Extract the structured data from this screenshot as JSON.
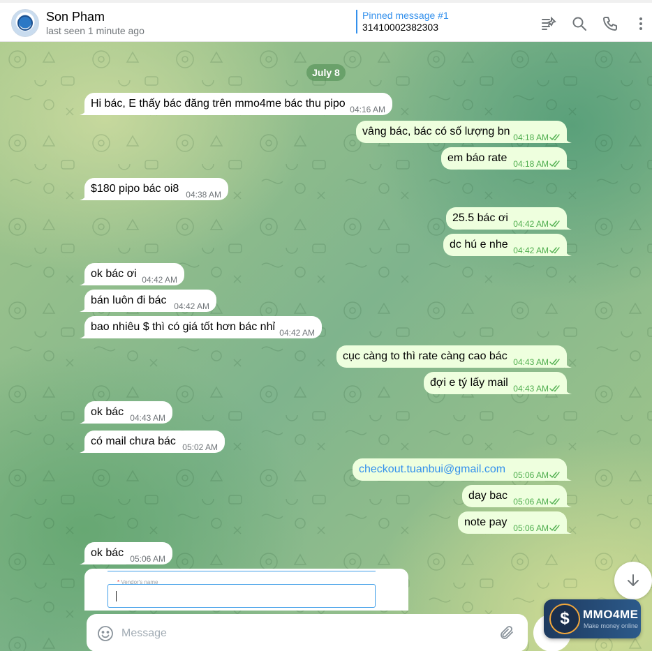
{
  "header": {
    "name": "Son Pham",
    "status": "last seen 1 minute ago",
    "pinned_title": "Pinned message #1",
    "pinned_text": "31410002382303",
    "icons": [
      "pinned-list-icon",
      "search-icon",
      "phone-icon",
      "more-vertical-icon"
    ]
  },
  "chat": {
    "date": "July 8",
    "messages": [
      {
        "dir": "in",
        "text": "Hi bác, E thấy bác đăng trên mmo4me bác thu pipo",
        "time": "04:16 AM"
      },
      {
        "dir": "out",
        "text": "vâng bác, bác có số lượng bn",
        "time": "04:18 AM"
      },
      {
        "dir": "out",
        "text": "em báo rate",
        "time": "04:18 AM"
      },
      {
        "dir": "in",
        "text": "$180 pipo bác oi8",
        "time": "04:38 AM"
      },
      {
        "dir": "out",
        "text": "25.5 bác ơi",
        "time": "04:42 AM"
      },
      {
        "dir": "out",
        "text": "dc hú e nhe",
        "time": "04:42 AM"
      },
      {
        "dir": "in",
        "text": "ok bác ơi",
        "time": "04:42 AM"
      },
      {
        "dir": "in",
        "text": "bán luôn đi bác",
        "time": "04:42 AM"
      },
      {
        "dir": "in",
        "text": "bao nhiêu $ thì có giá tốt hơn bác nhỉ",
        "time": "04:42 AM"
      },
      {
        "dir": "out",
        "text": "cục càng to thì rate càng cao bác",
        "time": "04:43 AM"
      },
      {
        "dir": "out",
        "text": "đợi e tý lấy mail",
        "time": "04:43 AM"
      },
      {
        "dir": "in",
        "text": "ok bác",
        "time": "04:43 AM"
      },
      {
        "dir": "in",
        "text": "có mail chưa bác",
        "time": "05:02 AM"
      },
      {
        "dir": "out",
        "text": "checkout.tuanbui@gmail.com",
        "time": "05:06 AM",
        "link": true
      },
      {
        "dir": "out",
        "text": "day bac",
        "time": "05:06 AM"
      },
      {
        "dir": "out",
        "text": "note pay",
        "time": "05:06 AM"
      },
      {
        "dir": "in",
        "text": "ok bác",
        "time": "05:06 AM"
      }
    ],
    "image_form": {
      "label_required": "*",
      "label": "Vendor's name"
    }
  },
  "composer": {
    "placeholder": "Message"
  },
  "watermark": {
    "name": "MMO4ME",
    "tagline": "Make money online"
  },
  "colors": {
    "accent": "#3390ec",
    "outgoing_bubble": "#eeffde",
    "incoming_bubble": "#ffffff",
    "read_check": "#4fae4e"
  }
}
